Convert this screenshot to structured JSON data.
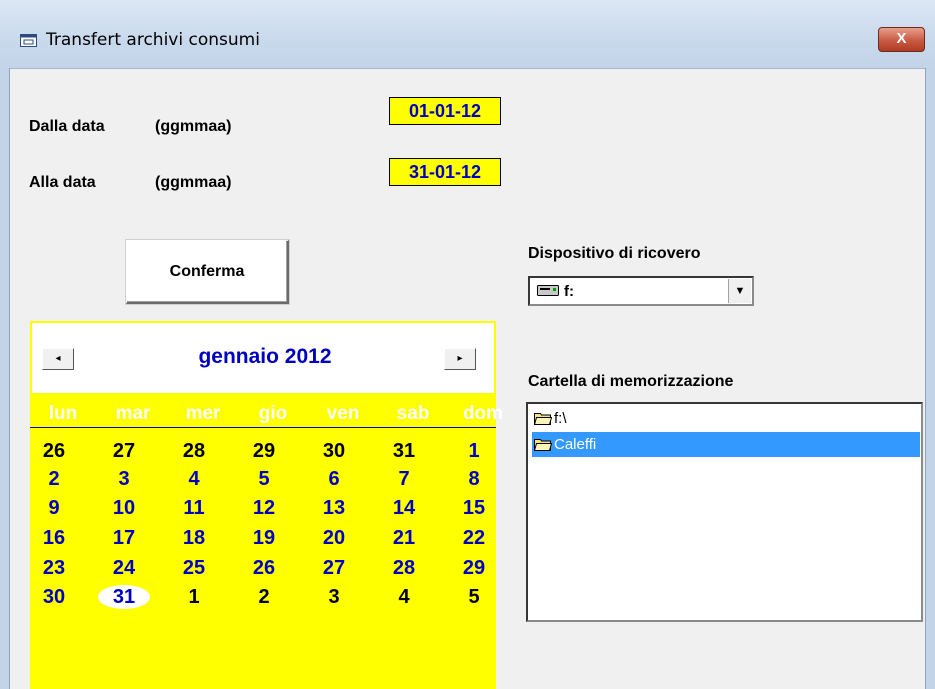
{
  "window": {
    "title": "Transfert archivi consumi",
    "close_label": "X"
  },
  "form": {
    "from_label": "Dalla data",
    "from_format": "(ggmmaa)",
    "from_value": "01-01-12",
    "to_label": "Alla data",
    "to_format": "(ggmmaa)",
    "to_value": "31-01-12",
    "confirm_label": "Conferma"
  },
  "device": {
    "label": "Dispositivo di ricovero",
    "selected": "f:",
    "icon": "drive-icon"
  },
  "folder": {
    "label": "Cartella di memorizzazione",
    "items": [
      {
        "text": "f:\\",
        "selected": false,
        "icon": "folder-open-icon"
      },
      {
        "text": "Caleffi",
        "selected": true,
        "icon": "folder-open-icon"
      }
    ]
  },
  "calendar": {
    "month_title": "gennaio 2012",
    "prev_label": "◂",
    "next_label": "▸",
    "weekdays": [
      "lun",
      "mar",
      "mer",
      "gio",
      "ven",
      "sab",
      "dom"
    ],
    "weeks": [
      [
        "26",
        "27",
        "28",
        "29",
        "30",
        "31",
        "1"
      ],
      [
        "2",
        "3",
        "4",
        "5",
        "6",
        "7",
        "8"
      ],
      [
        "9",
        "10",
        "11",
        "12",
        "13",
        "14",
        "15"
      ],
      [
        "16",
        "17",
        "18",
        "19",
        "20",
        "21",
        "22"
      ],
      [
        "23",
        "24",
        "25",
        "26",
        "27",
        "28",
        "29"
      ],
      [
        "30",
        "31",
        "1",
        "2",
        "3",
        "4",
        "5"
      ]
    ],
    "other_month": [
      [
        true,
        true,
        true,
        true,
        true,
        true,
        false
      ],
      [
        false,
        false,
        false,
        false,
        false,
        false,
        false
      ],
      [
        false,
        false,
        false,
        false,
        false,
        false,
        false
      ],
      [
        false,
        false,
        false,
        false,
        false,
        false,
        false
      ],
      [
        false,
        false,
        false,
        false,
        false,
        false,
        false
      ],
      [
        false,
        false,
        true,
        true,
        true,
        true,
        true
      ]
    ],
    "today": {
      "week": 5,
      "day": 1
    },
    "colors": {
      "background": "#ffff00",
      "day_text": "#0000c0",
      "other_month_text": "#000000",
      "weekday_text": "#ffffff"
    }
  }
}
